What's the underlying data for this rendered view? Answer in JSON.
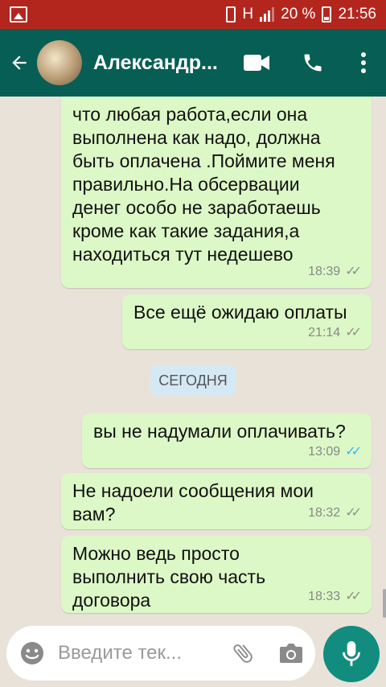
{
  "status_bar": {
    "network": "H",
    "battery": "20 %",
    "time": "21:56"
  },
  "header": {
    "contact_name": "Александр...",
    "icons": [
      "back-arrow-icon",
      "video-call-icon",
      "phone-icon",
      "more-vert-icon"
    ]
  },
  "chat": {
    "messages": [
      {
        "direction": "in",
        "text": "что любая работа,если она\nвыполнена как надо, должна\nбыть оплачена .Поймите меня\nправильно.На обсервации\nденег особо не заработаешь\nкроме как такие задания,а\nнаходиться тут недешево",
        "time": "18:39",
        "status": "delivered"
      },
      {
        "direction": "in",
        "text": "Все ещё ожидаю оплаты",
        "time": "21:14",
        "status": "delivered"
      },
      {
        "direction": "out",
        "text": "вы не надумали оплачивать?",
        "time": "13:09",
        "status": "read"
      },
      {
        "direction": "in",
        "text": "Не надоели сообщения мои\nвам?",
        "time": "18:32",
        "status": "delivered"
      },
      {
        "direction": "in",
        "text": "Можно ведь просто\nвыполнить свою часть\nдоговора",
        "time": "18:33",
        "status": "delivered"
      }
    ],
    "day_separator": "СЕГОДНЯ"
  },
  "input": {
    "placeholder": "Введите тек...",
    "icons": [
      "emoji-icon",
      "attach-icon",
      "camera-icon",
      "mic-icon"
    ]
  },
  "colors": {
    "status_bar": "#b3261e",
    "header": "#075e54",
    "outgoing_bubble": "#dcf8c6",
    "incoming_bubble": "#ffffff",
    "read_ticks": "#34b7f1",
    "mic_button": "#128c7e"
  }
}
